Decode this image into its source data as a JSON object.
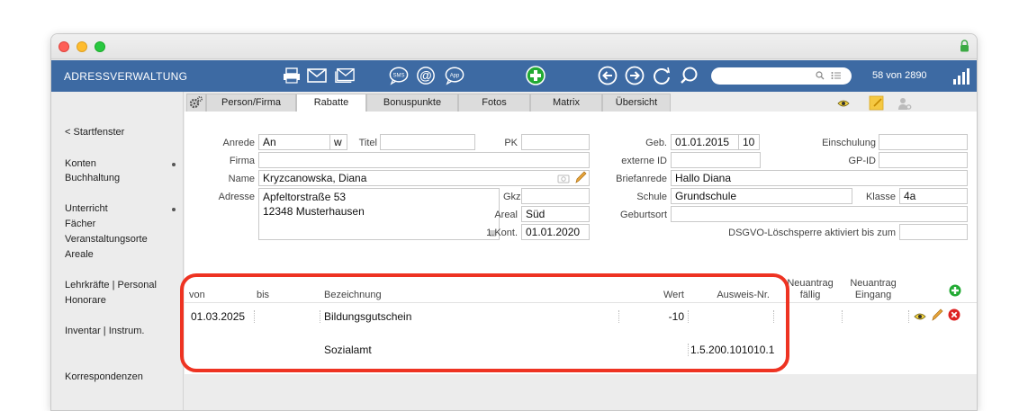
{
  "app": {
    "title": "ADRESSVERWALTUNG",
    "record_counter": "58 von 2890"
  },
  "colors": {
    "toolbar": "#3d6aa3",
    "annotation_box": "#ee3322",
    "add_green": "#22aa33",
    "delete_red": "#dd2222"
  },
  "toolbar": {
    "icons": [
      "print-icon",
      "mail-icon",
      "mail-open-icon",
      "sms-icon",
      "at-icon",
      "app-icon",
      "add-icon",
      "back-arrow-icon",
      "forward-arrow-icon",
      "refresh-icon",
      "search-icon"
    ],
    "sms_label": "SMS",
    "at_label": "@",
    "app_label": "App",
    "search": {
      "value": ""
    }
  },
  "sidebar": {
    "items": [
      {
        "label": "< Startfenster"
      },
      {
        "label": "Konten"
      },
      {
        "label": "Buchhaltung"
      },
      {
        "label": "Unterricht"
      },
      {
        "label": "Fächer"
      },
      {
        "label": "Veranstaltungsorte"
      },
      {
        "label": "Areale"
      },
      {
        "label": "Lehrkräfte | Personal"
      },
      {
        "label": "Honorare"
      },
      {
        "label": "Inventar | Instrum."
      },
      {
        "label": "Korrespondenzen"
      }
    ]
  },
  "tabs": [
    {
      "label": "Person/Firma"
    },
    {
      "label": "Rabatte"
    },
    {
      "label": "Bonuspunkte"
    },
    {
      "label": "Fotos"
    },
    {
      "label": "Matrix"
    },
    {
      "label": "Übersicht"
    }
  ],
  "form": {
    "anrede": {
      "label": "Anrede",
      "value": "An",
      "suffix": "w"
    },
    "titel": {
      "label": "Titel",
      "value": ""
    },
    "pk": {
      "label": "PK",
      "value": ""
    },
    "firma": {
      "label": "Firma",
      "value": ""
    },
    "name": {
      "label": "Name",
      "value": "Kryzcanowska, Diana"
    },
    "adresse": {
      "label": "Adresse",
      "line1": "Apfeltorstraße 53",
      "line2": "12348 Musterhausen"
    },
    "gkz": {
      "label": "Gkz",
      "value": ""
    },
    "areal": {
      "label": "Areal",
      "value": "Süd"
    },
    "erst_kontakt": {
      "label": "1.Kont.",
      "value": "01.01.2020"
    },
    "geb": {
      "label": "Geb.",
      "value": "01.01.2015",
      "age": "10"
    },
    "externe_id": {
      "label": "externe ID",
      "value": ""
    },
    "briefanrede": {
      "label": "Briefanrede",
      "value": "Hallo Diana"
    },
    "schule": {
      "label": "Schule",
      "value": "Grundschule"
    },
    "klasse": {
      "label": "Klasse",
      "value": "4a"
    },
    "geburtsort": {
      "label": "Geburtsort",
      "value": ""
    },
    "einschulung": {
      "label": "Einschulung",
      "value": ""
    },
    "gp_id": {
      "label": "GP-ID",
      "value": ""
    },
    "dsgvo": {
      "label": "DSGVO-Löschsperre aktiviert bis zum",
      "value": ""
    }
  },
  "discount_table": {
    "headers": {
      "von": "von",
      "bis": "bis",
      "bezeichnung": "Bezeichnung",
      "wert": "Wert",
      "ausweis": "Ausweis-Nr.",
      "neuantrag_faellig_1": "Neuantrag",
      "neuantrag_faellig_2": "fällig",
      "neuantrag_eingang_1": "Neuantrag",
      "neuantrag_eingang_2": "Eingang"
    },
    "rows": [
      {
        "von": "01.03.2025",
        "bis": "",
        "bezeichnung": "Bildungsgutschein",
        "wert": "-10",
        "ausweis": "",
        "sub_bezeichnung": "Sozialamt",
        "sub_ausweis": "1.5.200.101010.1"
      }
    ]
  }
}
